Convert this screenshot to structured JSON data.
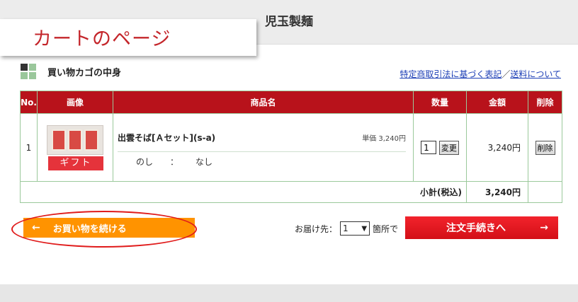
{
  "header": {
    "store_name": "児玉製麺",
    "page_label": "カートのページ"
  },
  "cart": {
    "title": "買い物カゴの中身",
    "links": {
      "law": "特定商取引法に基づく表記",
      "separator": "／",
      "shipping": "送料について"
    },
    "columns": [
      "No.",
      "画像",
      "商品名",
      "数量",
      "金額",
      "削除"
    ],
    "items": [
      {
        "no": "1",
        "gift_label": "ギフト",
        "name": "出雲そば[Ａセット](s-a)",
        "unit_price": "単価 3,240円",
        "option_name": "のし",
        "option_sep": "：",
        "option_value": "なし",
        "quantity": "1",
        "change_label": "変更",
        "amount": "3,240円",
        "delete_label": "削除"
      }
    ],
    "subtotal_label": "小計(税込)",
    "subtotal_value": "3,240円"
  },
  "actions": {
    "continue_arrow": "←",
    "continue_label": "お買い物を続ける",
    "ship_prefix": "お届け先：",
    "ship_count": "1",
    "ship_suffix": "箇所で",
    "checkout_label": "注文手続きへ",
    "checkout_arrow": "→"
  },
  "colors": {
    "accent_red": "#b8121b",
    "continue_orange": "#ff9300",
    "checkout_red": "#e3141d",
    "border_green": "#9bc99b"
  }
}
